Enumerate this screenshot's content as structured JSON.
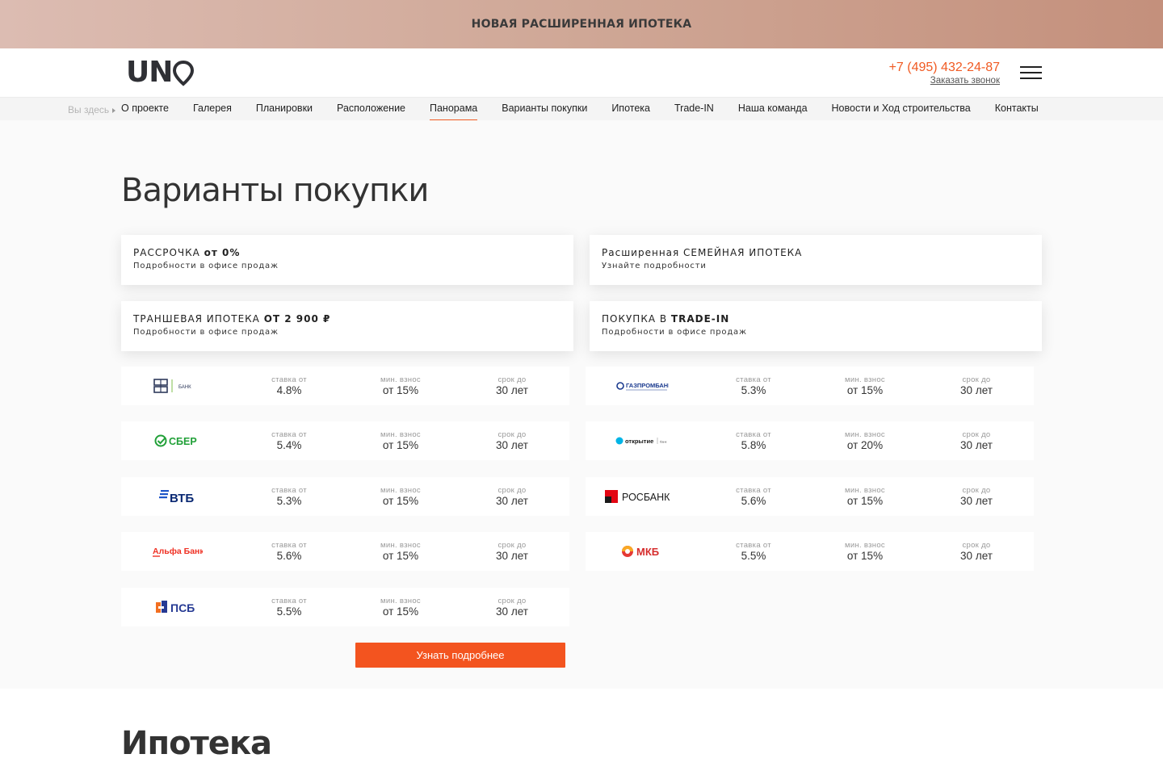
{
  "promo": {
    "text": "НОВАЯ РАСШИРЕННАЯ ИПОТЕКА"
  },
  "header": {
    "logo_text": "UN",
    "phone": "+7 (495) 432-24-87",
    "callback": "Заказать звонок",
    "accent_color": "#f05a22"
  },
  "nav": {
    "crumb": "Вы здесь",
    "items": [
      "О проекте",
      "Галерея",
      "Планировки",
      "Расположение",
      "Панорама",
      "Варианты покупки",
      "Ипотека",
      "Trade-IN",
      "Наша команда",
      "Новости и Ход строительства",
      "Контакты"
    ],
    "active": "Панорама"
  },
  "main": {
    "title": "Варианты покупки",
    "options": [
      {
        "title_a": "РАССРОЧКА ",
        "title_b": "от 0%",
        "sub": "Подробности в офисе продаж"
      },
      {
        "title_a": "Расширенная СЕМЕЙНАЯ ИПОТЕКА",
        "title_b": "",
        "sub": "Узнайте подробности"
      },
      {
        "title_a": "ТРАНШЕВАЯ ИПОТЕКА ",
        "title_b": "ОТ 2 900 ₽",
        "sub": "Подробности в офисе продаж"
      },
      {
        "title_a": "ПОКУПКА В ",
        "title_b": "TRADE-IN",
        "sub": "Подробности в офисе продаж"
      }
    ],
    "labels": {
      "rate": "ставка от",
      "down": "мин. взнос",
      "term": "срок до"
    },
    "banks": [
      {
        "name": "ДОМ.РФ БАНК",
        "logo": "domrf-logo",
        "rate": "4.8%",
        "down": "от 15%",
        "term": "30 лет"
      },
      {
        "name": "ГАЗПРОМБАНК",
        "logo": "gazprombank-logo",
        "rate": "5.3%",
        "down": "от 15%",
        "term": "30 лет"
      },
      {
        "name": "СБЕР",
        "logo": "sber-logo",
        "rate": "5.4%",
        "down": "от 15%",
        "term": "30 лет"
      },
      {
        "name": "открытие",
        "logo": "otkritie-logo",
        "rate": "5.8%",
        "down": "от 20%",
        "term": "30 лет"
      },
      {
        "name": "ВТБ",
        "logo": "vtb-logo",
        "rate": "5.3%",
        "down": "от 15%",
        "term": "30 лет"
      },
      {
        "name": "РОСБАНК",
        "logo": "rosbank-logo",
        "rate": "5.6%",
        "down": "от 15%",
        "term": "30 лет"
      },
      {
        "name": "Альфа Банк",
        "logo": "alfabank-logo",
        "rate": "5.6%",
        "down": "от 15%",
        "term": "30 лет"
      },
      {
        "name": "МКБ",
        "logo": "mkb-logo",
        "rate": "5.5%",
        "down": "от 15%",
        "term": "30 лет"
      },
      {
        "name": "ПСБ",
        "logo": "psb-logo",
        "rate": "5.5%",
        "down": "от 15%",
        "term": "30 лет"
      }
    ],
    "cta": "Узнать подробнее"
  },
  "next_section": {
    "title": "Ипотека"
  }
}
